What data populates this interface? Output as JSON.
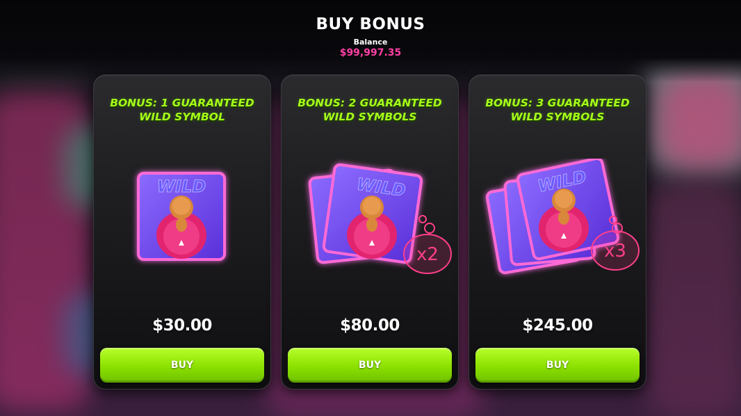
{
  "header": {
    "title": "BUY BONUS",
    "balance_label": "Balance",
    "balance_value": "$99,997.35"
  },
  "colors": {
    "accent_green": "#a6ff1a",
    "balance_pink": "#ff3fa6",
    "button_green": "#8be000"
  },
  "cards": [
    {
      "title_line1": "BONUS: 1 GUARANTEED",
      "title_line2": "WILD SYMBOL",
      "price": "$30.00",
      "buy_label": "BUY",
      "card_word": "WILD",
      "icon": "wild-symbol-icon"
    },
    {
      "title_line1": "BONUS: 2 GUARANTEED",
      "title_line2": "WILD SYMBOLS",
      "price": "$80.00",
      "buy_label": "BUY",
      "card_word": "WILD",
      "multiplier": "x2",
      "icon": "wild-symbols-x2-icon"
    },
    {
      "title_line1": "BONUS: 3 GUARANTEED",
      "title_line2": "WILD SYMBOLS",
      "price": "$245.00",
      "buy_label": "BUY",
      "card_word": "WILD",
      "multiplier": "x3",
      "icon": "wild-symbols-x3-icon"
    }
  ]
}
